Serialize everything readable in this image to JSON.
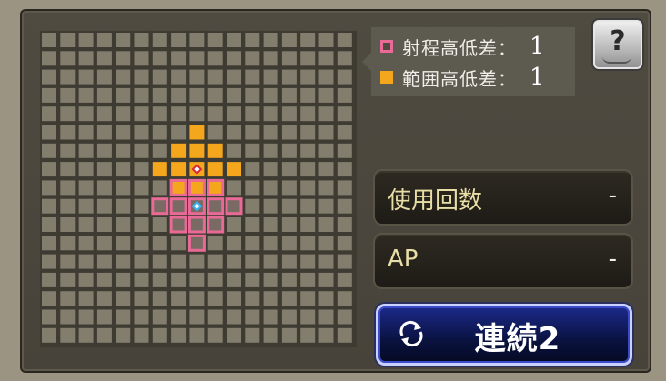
{
  "legend": {
    "range_label": "射程高低差：",
    "range_value": "1",
    "area_label": "範囲高低差：",
    "area_value": "1"
  },
  "help_glyph": "?",
  "stats": {
    "uses_label": "使用回数",
    "uses_value": "-",
    "ap_label": "AP",
    "ap_value": "-"
  },
  "chain_button": {
    "label": "連続2",
    "icon": "cycle-arrows-icon"
  },
  "colors": {
    "range": "#e96a96",
    "area": "#f4a61c",
    "cell": "#827d6c",
    "origin": "#3ab4f2",
    "target": "#d8283c"
  },
  "grid": {
    "cols": 17,
    "rows": 17,
    "area_cells": [
      [
        8,
        5
      ],
      [
        7,
        6
      ],
      [
        8,
        6
      ],
      [
        9,
        6
      ],
      [
        6,
        7
      ],
      [
        7,
        7
      ],
      [
        8,
        7
      ],
      [
        9,
        7
      ],
      [
        10,
        7
      ],
      [
        7,
        8
      ],
      [
        8,
        8
      ],
      [
        9,
        8
      ]
    ],
    "range_cells": [
      [
        7,
        8
      ],
      [
        8,
        8
      ],
      [
        9,
        8
      ],
      [
        6,
        9
      ],
      [
        7,
        9
      ],
      [
        8,
        9
      ],
      [
        9,
        9
      ],
      [
        10,
        9
      ],
      [
        7,
        10
      ],
      [
        8,
        10
      ],
      [
        9,
        10
      ],
      [
        8,
        11
      ]
    ],
    "target_cell": [
      8,
      7
    ],
    "origin_cell": [
      8,
      9
    ]
  }
}
